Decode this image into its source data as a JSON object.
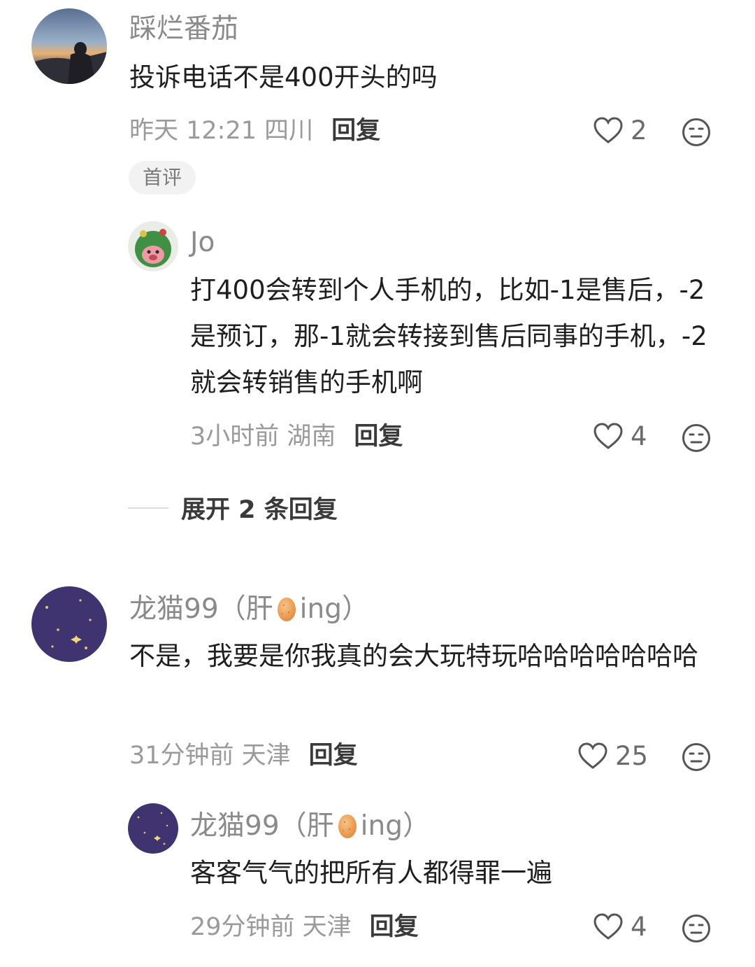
{
  "comments": [
    {
      "username": "踩烂番茄",
      "text": "投诉电话不是400开头的吗",
      "meta": "昨天 12:21 四川",
      "reply_label": "回复",
      "likes": "2",
      "badge": "首评",
      "avatar": "mountain-person-avatar",
      "replies": [
        {
          "username": "Jo",
          "text": "打400会转到个人手机的，比如-1是售后，-2是预订，那-1就会转接到售后同事的手机，-2就会转销售的手机啊",
          "meta": "3小时前 湖南",
          "reply_label": "回复",
          "likes": "4",
          "avatar": "green-plush-avatar"
        }
      ],
      "expand_label": "展开 2 条回复"
    },
    {
      "username_prefix": "龙猫99（肝",
      "username_suffix": "ing）",
      "username_icon": "egg-icon",
      "text": "不是，我要是你我真的会大玩特玩哈哈哈哈哈哈哈",
      "meta": "31分钟前 天津",
      "reply_label": "回复",
      "likes": "25",
      "avatar": "purple-stars-avatar",
      "replies": [
        {
          "username_prefix": "龙猫99（肝",
          "username_suffix": "ing）",
          "username_icon": "egg-icon",
          "text": "客客气气的把所有人都得罪一遍",
          "meta": "29分钟前 天津",
          "reply_label": "回复",
          "likes": "4",
          "avatar": "purple-stars-avatar"
        }
      ]
    }
  ],
  "colors": {
    "username": "#8a8a8a",
    "text": "#1f1f1f",
    "meta": "#9a9a9a",
    "reply": "#3a3a3a",
    "badge_bg": "#f2f2f2",
    "avatar_purple": "#3f3470"
  }
}
